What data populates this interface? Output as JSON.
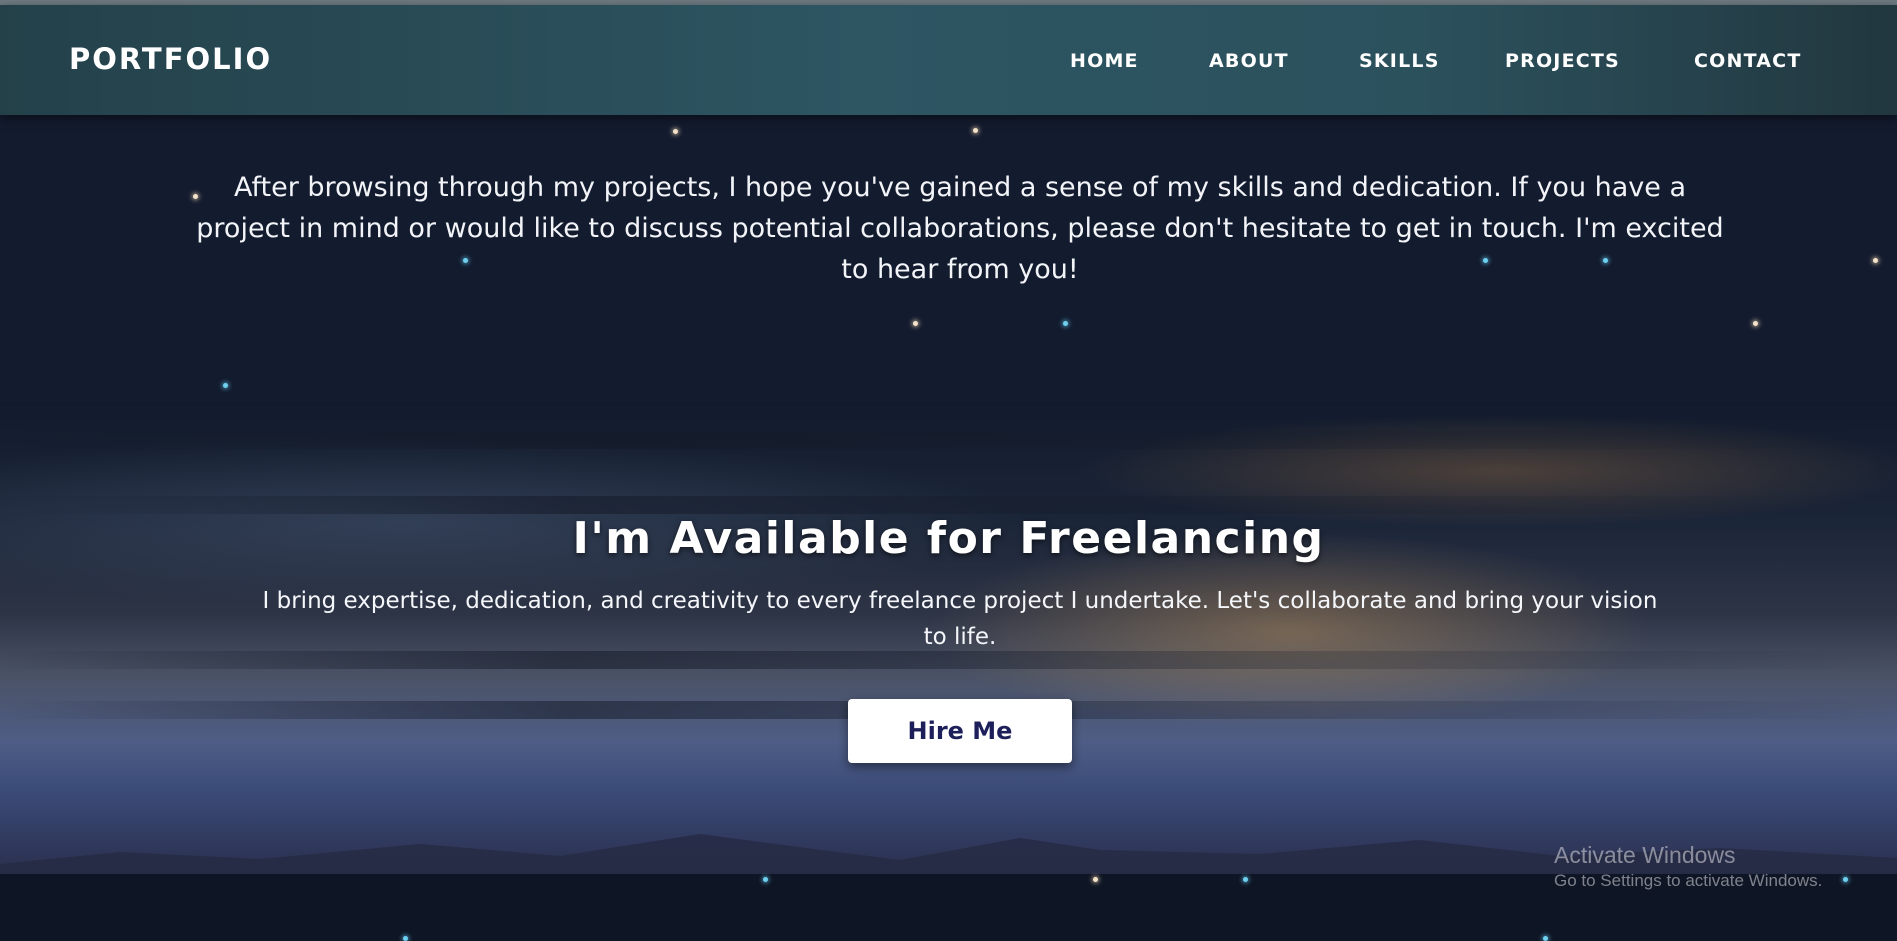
{
  "header": {
    "brand": "PORTFOLIO",
    "nav": [
      "HOME",
      "ABOUT",
      "SKILLS",
      "PROJECTS",
      "CONTACT"
    ]
  },
  "contact": {
    "text": "After browsing through my projects, I hope you've gained a sense of my skills and dedication. If you have a project in mind or would like to discuss potential collaborations, please don't hesitate to get in touch. I'm excited to hear from you!"
  },
  "freelance": {
    "title": "I'm Available for Freelancing",
    "description": "I bring expertise, dedication, and creativity to every freelance project I undertake. Let's collaborate and bring your vision to life.",
    "button_label": "Hire Me"
  },
  "watermark": {
    "title": "Activate Windows",
    "subtitle": "Go to Settings to activate Windows."
  },
  "colors": {
    "nav_background": "#2d5562",
    "page_background": "#131b2e",
    "button_background": "#ffffff",
    "button_text": "#1c1f5a",
    "star_warm": "#f4e3c8",
    "star_cool": "#6fd0f0"
  }
}
